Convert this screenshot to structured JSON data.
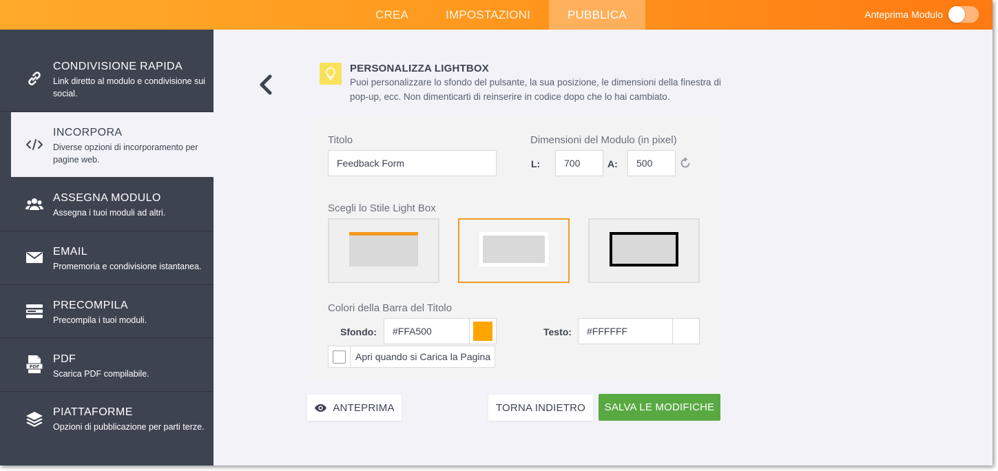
{
  "topbar": {
    "tabs": [
      {
        "label": "CREA"
      },
      {
        "label": "IMPOSTAZIONI"
      },
      {
        "label": "PUBBLICA"
      }
    ],
    "active_tab": "PUBBLICA",
    "preview_toggle_label": "Anteprima Modulo",
    "preview_toggle_on": false
  },
  "sidebar": {
    "items": [
      {
        "title": "CONDIVISIONE RAPIDA",
        "desc": "Link diretto al modulo e condivisione sui social.",
        "icon": "link-icon"
      },
      {
        "title": "INCORPORA",
        "desc": "Diverse opzioni di incorporamento per pagine web.",
        "icon": "code-icon",
        "active": true
      },
      {
        "title": "ASSEGNA MODULO",
        "desc": "Assegna i tuoi moduli ad altri.",
        "icon": "users-icon"
      },
      {
        "title": "EMAIL",
        "desc": "Promemoria e condivisione istantanea.",
        "icon": "envelope-icon"
      },
      {
        "title": "PRECOMPILA",
        "desc": "Precompila i tuoi moduli.",
        "icon": "prefill-icon"
      },
      {
        "title": "PDF",
        "desc": "Scarica PDF compilabile.",
        "icon": "pdf-icon"
      },
      {
        "title": "PIATTAFORME",
        "desc": "Opzioni di pubblicazione per parti terze.",
        "icon": "layers-icon"
      }
    ]
  },
  "header": {
    "title": "PERSONALIZZA LIGHTBOX",
    "description": "Puoi personalizzare lo sfondo del pulsante, la sua posizione, le dimensioni della finestra di pop-up, ecc. Non dimenticarti di reinserire in codice dopo che lo hai cambiato.",
    "icon": "lightbulb-icon"
  },
  "form": {
    "title_label": "Titolo",
    "title_value": "Feedback Form",
    "dimensions_label": "Dimensioni del Modulo (in pixel)",
    "width_label": "L:",
    "width_value": "700",
    "height_label": "A:",
    "height_value": "500",
    "style_label": "Scegli lo Stile Light Box",
    "selected_style": 2,
    "colors_label": "Colori della Barra del Titolo",
    "bg_label": "Sfondo:",
    "bg_value": "#FFA500",
    "text_label": "Testo:",
    "text_value": "#FFFFFF",
    "open_on_load_label": "Apri quando si Carica la Pagina",
    "open_on_load_checked": false
  },
  "buttons": {
    "preview": "ANTEPRIMA",
    "back": "TORNA INDIETRO",
    "save": "SALVA LE MODIFICHE"
  },
  "colors": {
    "accent": "#FF9A1F",
    "sidebar_bg": "#3E4350",
    "save_green": "#58A942",
    "selected_border": "#F29A1E"
  }
}
